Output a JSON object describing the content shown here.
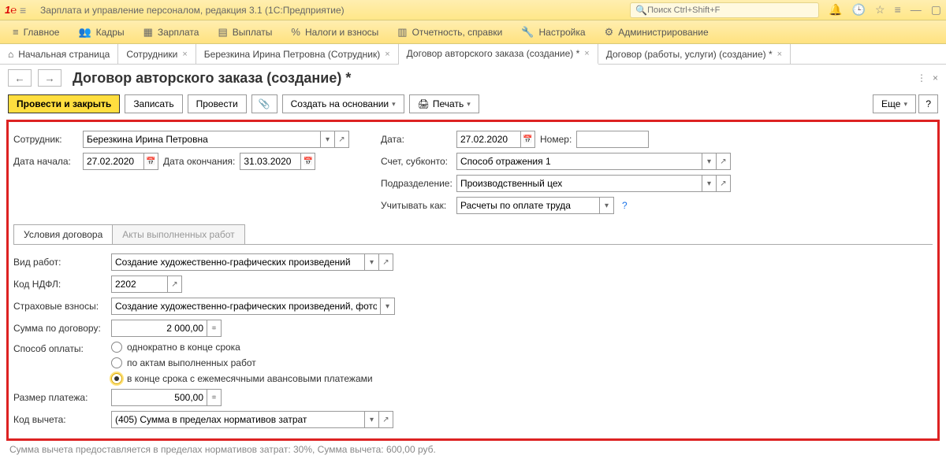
{
  "title_bar": {
    "app_title": "Зарплата и управление персоналом, редакция 3.1  (1С:Предприятие)",
    "search_placeholder": "Поиск Ctrl+Shift+F"
  },
  "menu": {
    "main": "Главное",
    "staff": "Кадры",
    "salary": "Зарплата",
    "payments": "Выплаты",
    "taxes": "Налоги и взносы",
    "reports": "Отчетность, справки",
    "settings": "Настройка",
    "admin": "Администрирование"
  },
  "tabs": {
    "home": "Начальная страница",
    "employees": "Сотрудники",
    "employee": "Березкина Ирина Петровна (Сотрудник)",
    "author": "Договор авторского заказа (создание) *",
    "works": "Договор (работы, услуги) (создание) *"
  },
  "page": {
    "title": "Договор авторского заказа (создание) *"
  },
  "toolbar": {
    "post_close": "Провести и закрыть",
    "save": "Записать",
    "post": "Провести",
    "create_based": "Создать на основании",
    "print": "Печать",
    "more": "Еще"
  },
  "form": {
    "employee_lbl": "Сотрудник:",
    "employee": "Березкина Ирина Петровна",
    "date_lbl": "Дата:",
    "date": "27.02.2020",
    "number_lbl": "Номер:",
    "number": "",
    "start_lbl": "Дата начала:",
    "start": "27.02.2020",
    "end_lbl": "Дата окончания:",
    "end": "31.03.2020",
    "account_lbl": "Счет, субконто:",
    "account": "Способ отражения 1",
    "dept_lbl": "Подразделение:",
    "dept": "Производственный цех",
    "count_as_lbl": "Учитывать как:",
    "count_as": "Расчеты по оплате труда",
    "tab_terms": "Условия договора",
    "tab_acts": "Акты выполненных работ",
    "work_type_lbl": "Вид работ:",
    "work_type": "Создание художественно-графических произведений",
    "ndfl_lbl": "Код НДФЛ:",
    "ndfl": "2202",
    "insurance_lbl": "Страховые взносы:",
    "insurance": "Создание художественно-графических произведений, фотораб",
    "sum_lbl": "Сумма по договору:",
    "sum": "2 000,00",
    "pay_method_lbl": "Способ оплаты:",
    "pay_opt1": "однократно в конце срока",
    "pay_opt2": "по актам выполненных работ",
    "pay_opt3": "в конце срока с ежемесячными авансовыми платежами",
    "payment_size_lbl": "Размер платежа:",
    "payment_size": "500,00",
    "deduction_lbl": "Код вычета:",
    "deduction": "(405) Сумма в пределах нормативов затрат"
  },
  "summary": "Сумма вычета предоставляется в пределах нормативов затрат: 30%,  Сумма вычета: 600,00 руб."
}
